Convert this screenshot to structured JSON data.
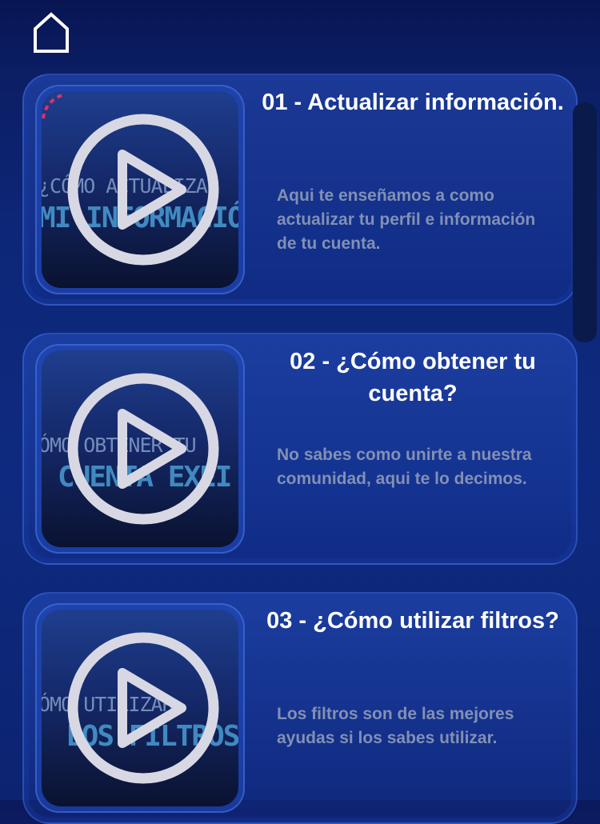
{
  "header": {
    "home_icon": "home-icon"
  },
  "videos": [
    {
      "title": "01 - Actualizar información.",
      "description": "Aqui te enseñamos a como actualizar tu perfil e información de tu cuenta.",
      "thumb_line1": "¿Cómo actualizar",
      "thumb_line2": "mi información"
    },
    {
      "title": "02 - ¿Cómo obtener tu cuenta?",
      "description": "No sabes como unirte a nuestra comunidad, aqui te lo decimos.",
      "thumb_line1": "ómo obtener tu",
      "thumb_line2": "cuenta Exei"
    },
    {
      "title": "03 - ¿Cómo utilizar filtros?",
      "description": "Los filtros son de las mejores ayudas si los sabes utilizar.",
      "thumb_line1": "ómo utilizar",
      "thumb_line2": "los filtros"
    }
  ],
  "colors": {
    "background": "#0d2778",
    "title_text": "#ffffff",
    "description_text": "#8290b4",
    "thumb_accent": "#e0306a"
  }
}
